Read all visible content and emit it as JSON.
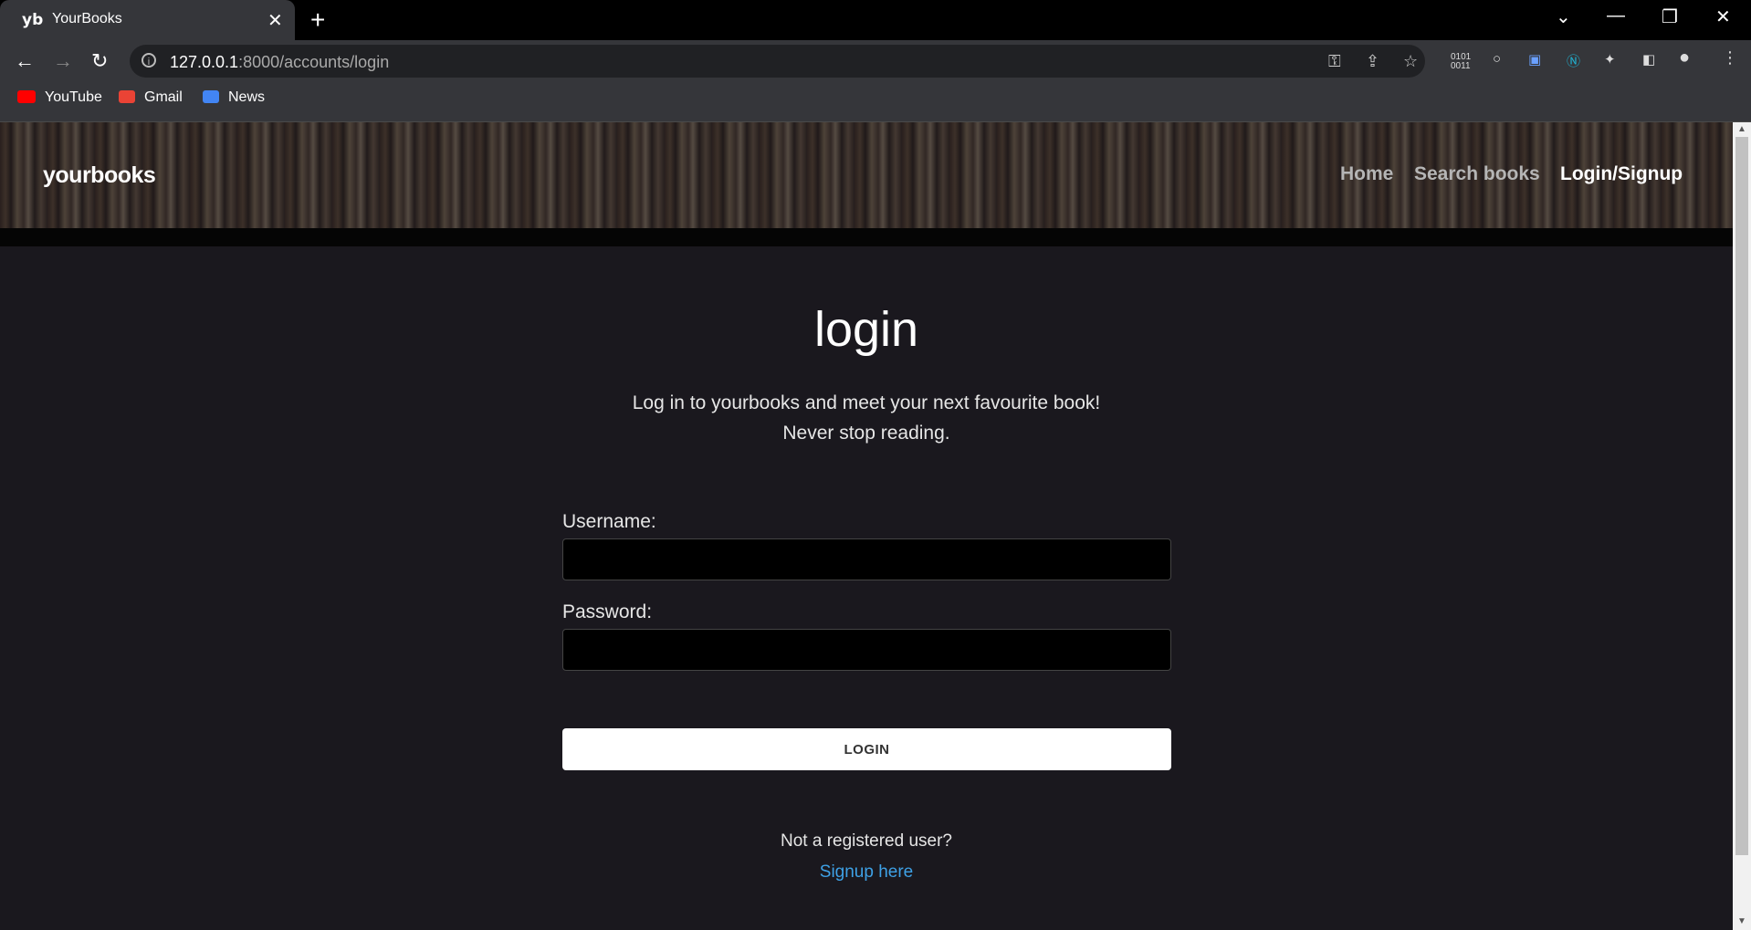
{
  "browser": {
    "tab": {
      "favicon": "yb",
      "title": "YourBooks",
      "close": "✕"
    },
    "new_tab": "+",
    "url": {
      "host": "127.0.0.1",
      "path": ":8000/accounts/login"
    },
    "bookmarks": [
      {
        "label": "YouTube",
        "color": "#ff0000"
      },
      {
        "label": "Gmail",
        "color": "#ea4335"
      },
      {
        "label": "News",
        "color": "#4285f4"
      }
    ]
  },
  "site": {
    "brand": "yourbooks",
    "nav": [
      {
        "label": "Home",
        "active": false
      },
      {
        "label": "Search books",
        "active": false
      },
      {
        "label": "Login/Signup",
        "active": true
      }
    ]
  },
  "login": {
    "title": "login",
    "tagline_line1": "Log in to yourbooks and meet your next favourite book!",
    "tagline_line2": "Never stop reading.",
    "username_label": "Username:",
    "username_value": "",
    "password_label": "Password:",
    "password_value": "",
    "submit_label": "LOGIN",
    "not_registered": "Not a registered user?",
    "signup_link": "Signup here"
  },
  "colors": {
    "page_bg": "#1a181e",
    "link": "#3ea1e6",
    "button_bg": "#ffffff"
  }
}
